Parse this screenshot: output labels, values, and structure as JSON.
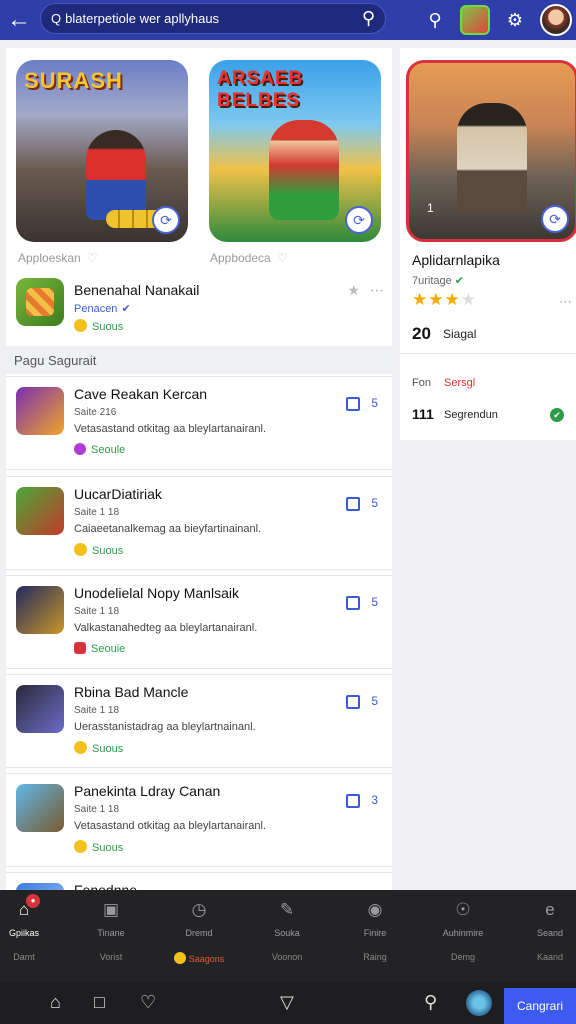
{
  "topbar": {
    "search_prefix": "Q",
    "search_text": "blaterpetiole wer apllyhaus"
  },
  "featured": [
    {
      "title": "SURASH",
      "label": "Apploeskan"
    },
    {
      "title": "ARSAEB BELBES",
      "label": "Appbodeca"
    }
  ],
  "main_app": {
    "title": "Benenahal Nanakail",
    "developer": "Penacen",
    "status": "Suous"
  },
  "section_title": "Pagu Sagurait",
  "cards": [
    {
      "title": "Cave Reakan Kercan",
      "meta": "Saite 216",
      "desc": "Vetasastand otkitag aa bleylartanairanl.",
      "status": "Seoule",
      "num": "5"
    },
    {
      "title": "UucarDiatiriak",
      "meta": "Saite 1 18",
      "desc": "Caiaeetanalkemag aa bieyfartinainanl.",
      "status": "Suous",
      "num": "5"
    },
    {
      "title": "Unodelielal Nopy Manlsaik",
      "meta": "Saite 1 18",
      "desc": "Valkastanahedteg aa bleylartanairanl.",
      "status": "Seouie",
      "num": "5"
    },
    {
      "title": "Rbina Bad Mancle",
      "meta": "Saite 1 18",
      "desc": "Uerasstanistadrag aa bleylartnainanl.",
      "status": "Suous",
      "num": "5"
    },
    {
      "title": "Panekinta Ldray Canan",
      "meta": "Saite 1 18",
      "desc": "Vetasastand otkitag aa bleylartanairanl.",
      "status": "Suous",
      "num": "3"
    },
    {
      "title": "Fenednne",
      "meta": "",
      "desc": "",
      "status": "",
      "num": ""
    }
  ],
  "right_panel": {
    "title": "Aplidarnlapika",
    "subtitle": "7uritage",
    "rating": 3,
    "count": "20",
    "count_label": "Siagal",
    "on_label": "Fon",
    "on_value": "Sersgl",
    "count2": "111",
    "count2_label": "Segrendun",
    "image_label": "1"
  },
  "bottom_nav": [
    {
      "label": "Gpiikas",
      "sub": "Damt"
    },
    {
      "label": "Tinane",
      "sub": "Vorist"
    },
    {
      "label": "Dremd",
      "sub": "Saagons"
    },
    {
      "label": "Souka",
      "sub": "Voonon"
    },
    {
      "label": "Finire",
      "sub": "Raing"
    },
    {
      "label": "Auhinmire",
      "sub": "Demg"
    },
    {
      "label": "Seand",
      "sub": "Kaand"
    }
  ],
  "cta_label": "Cangrari",
  "colors": {
    "accent": "#2f3ea8",
    "cta": "#3d5af1",
    "status_green": "#2d9c4a",
    "alert_red": "#d8323c"
  }
}
